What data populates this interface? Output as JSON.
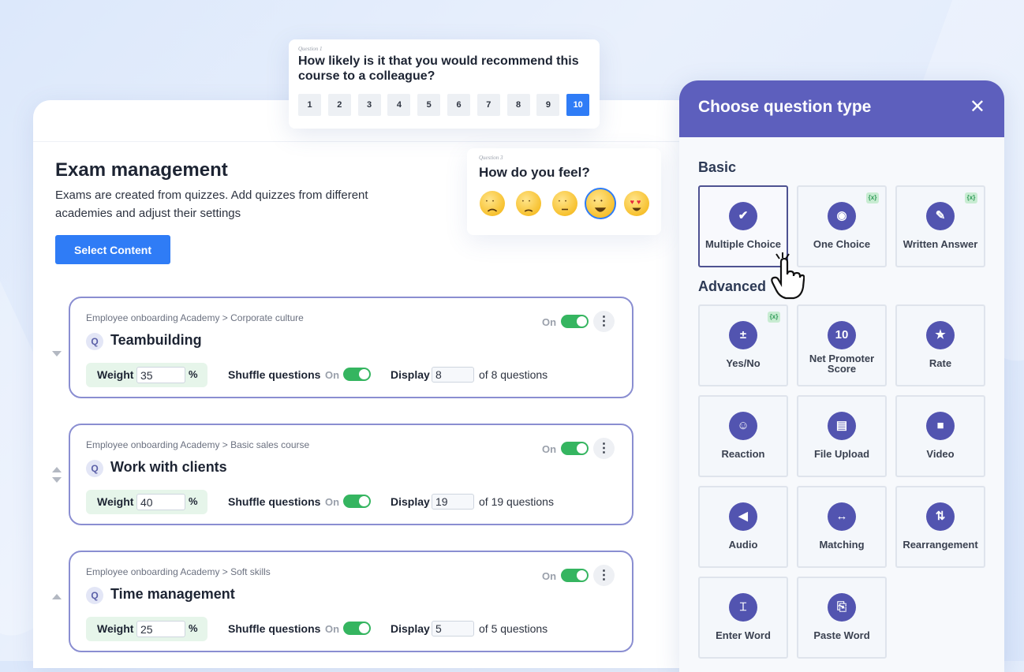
{
  "main": {
    "title": "Exam management",
    "description": "Exams are created from quizzes. Add quizzes from different academies and adjust their settings",
    "select_button": "Select Content"
  },
  "quizzes": [
    {
      "breadcrumb": "Employee onboarding Academy > Corporate culture",
      "title": "Teambuilding",
      "badge": "Q",
      "on_label": "On",
      "weight_label": "Weight",
      "weight": "35",
      "percent": "%",
      "shuffle_label": "Shuffle questions",
      "shuffle_on": "On",
      "display_label": "Display",
      "display": "8",
      "of_label": "of 8 questions",
      "kebab": "⋮"
    },
    {
      "breadcrumb": "Employee onboarding Academy > Basic sales course",
      "title": "Work with clients",
      "badge": "Q",
      "on_label": "On",
      "weight_label": "Weight",
      "weight": "40",
      "percent": "%",
      "shuffle_label": "Shuffle questions",
      "shuffle_on": "On",
      "display_label": "Display",
      "display": "19",
      "of_label": "of 19 questions",
      "kebab": "⋮"
    },
    {
      "breadcrumb": "Employee onboarding Academy > Soft skills",
      "title": "Time management",
      "badge": "Q",
      "on_label": "On",
      "weight_label": "Weight",
      "weight": "25",
      "percent": "%",
      "shuffle_label": "Shuffle questions",
      "shuffle_on": "On",
      "display_label": "Display",
      "display": "5",
      "of_label": "of 5 questions",
      "kebab": "⋮"
    }
  ],
  "nps_card": {
    "small_label": "Question 1",
    "question": "How likely is it that you would recommend this course to a colleague?",
    "scale": [
      "1",
      "2",
      "3",
      "4",
      "5",
      "6",
      "7",
      "8",
      "9",
      "10"
    ],
    "selected": "10"
  },
  "feel_card": {
    "small_label": "Question 3",
    "question": "How do you feel?",
    "emojis": [
      "disappointed",
      "slightly-frowning",
      "neutral",
      "smiling",
      "heart-eyes"
    ],
    "selected": "smiling"
  },
  "question_type_panel": {
    "title": "Choose question type",
    "close": "✕",
    "basic_label": "Basic",
    "advanced_label": "Advanced",
    "ai_badge": "{x}",
    "basic": [
      {
        "label": "Multiple Choice",
        "icon": "checkbox-icon",
        "glyph": "✔",
        "selected": true,
        "ai": false
      },
      {
        "label": "One Choice",
        "icon": "radio-icon",
        "glyph": "◉",
        "selected": false,
        "ai": true
      },
      {
        "label": "Written Answer",
        "icon": "pencil-icon",
        "glyph": "✎",
        "selected": false,
        "ai": true
      }
    ],
    "advanced": [
      {
        "label": "Yes/No",
        "icon": "plus-minus-icon",
        "glyph": "±",
        "ai": true
      },
      {
        "label": "Net Promoter Score",
        "icon": "nps-10-icon",
        "glyph": "10",
        "ai": false
      },
      {
        "label": "Rate",
        "icon": "star-icon",
        "glyph": "★",
        "ai": false
      },
      {
        "label": "Reaction",
        "icon": "smiley-icon",
        "glyph": "☺",
        "ai": false
      },
      {
        "label": "File Upload",
        "icon": "file-icon",
        "glyph": "▤",
        "ai": false
      },
      {
        "label": "Video",
        "icon": "video-camera-icon",
        "glyph": "■",
        "ai": false
      },
      {
        "label": "Audio",
        "icon": "speaker-icon",
        "glyph": "◀",
        "ai": false
      },
      {
        "label": "Matching",
        "icon": "double-arrow-icon",
        "glyph": "↔",
        "ai": false
      },
      {
        "label": "Rearrangement",
        "icon": "sort-icon",
        "glyph": "⇅",
        "ai": false
      },
      {
        "label": "Enter Word",
        "icon": "text-cursor-icon",
        "glyph": "⌶",
        "ai": false
      },
      {
        "label": "Paste Word",
        "icon": "paste-icon",
        "glyph": "⎘",
        "ai": false
      }
    ]
  },
  "colors": {
    "accent": "#2f7cf6",
    "panel_header": "#5d5fbd",
    "toggle_on": "#35b560",
    "icon_bg": "#5254b0"
  }
}
